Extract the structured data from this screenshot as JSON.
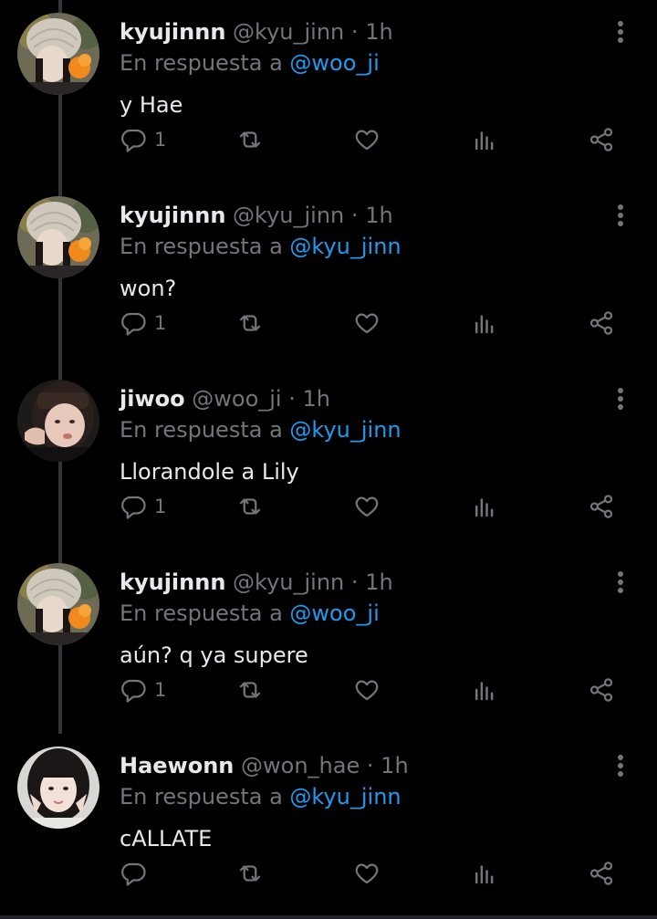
{
  "tweets": [
    {
      "name": "kyujinnn",
      "handle": "@kyu_jinn",
      "dot": "·",
      "time": "1h",
      "reply_prefix": "En respuesta a",
      "reply_to": "@woo_ji",
      "text": "y Hae",
      "reply_count": "1",
      "avatar": "avatar-kyujinnn"
    },
    {
      "name": "kyujinnn",
      "handle": "@kyu_jinn",
      "dot": "·",
      "time": "1h",
      "reply_prefix": "En respuesta a",
      "reply_to": "@kyu_jinn",
      "text": "won?",
      "reply_count": "1",
      "avatar": "avatar-kyujinnn"
    },
    {
      "name": "jiwoo",
      "handle": "@woo_ji",
      "dot": "·",
      "time": "1h",
      "reply_prefix": "En respuesta a",
      "reply_to": "@kyu_jinn",
      "text": "Llorandole a Lily",
      "reply_count": "1",
      "avatar": "avatar-jiwoo"
    },
    {
      "name": "kyujinnn",
      "handle": "@kyu_jinn",
      "dot": "·",
      "time": "1h",
      "reply_prefix": "En respuesta a",
      "reply_to": "@woo_ji",
      "text": "aún? q ya supere",
      "reply_count": "1",
      "avatar": "avatar-kyujinnn"
    },
    {
      "name": "Haewonn",
      "handle": "@won_hae",
      "dot": "·",
      "time": "1h",
      "reply_prefix": "En respuesta a",
      "reply_to": "@kyu_jinn",
      "text": "cALLATE",
      "reply_count": "",
      "avatar": "avatar-haewonn"
    }
  ],
  "colors": {
    "background": "#000000",
    "primary_text": "#e7e9ea",
    "secondary_text": "#71767b",
    "mention": "#1d9bf0",
    "thread_line": "#333639"
  },
  "icons": {
    "reply": "reply-icon",
    "retweet": "retweet-icon",
    "like": "heart-icon",
    "views": "views-icon",
    "share": "share-icon",
    "more": "more-vertical-icon"
  }
}
